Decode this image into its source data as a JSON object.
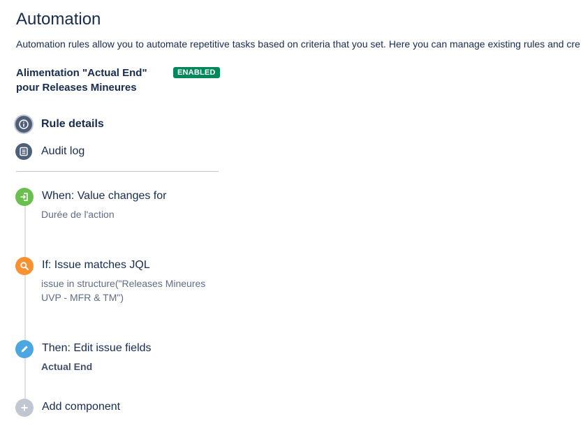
{
  "header": {
    "title": "Automation",
    "description": "Automation rules allow you to automate repetitive tasks based on criteria that you set. Here you can manage existing rules and cre"
  },
  "rule": {
    "name_line1": "Alimentation \"Actual End\"",
    "name_line2": "pour Releases Mineures",
    "status": "ENABLED"
  },
  "nav": {
    "items": [
      {
        "label": "Rule details",
        "icon": "info-icon",
        "active": true
      },
      {
        "label": "Audit log",
        "icon": "list-icon",
        "active": false
      }
    ]
  },
  "steps": [
    {
      "title": "When: Value changes for",
      "detail": "Durée de l'action",
      "icon": "trigger-icon",
      "color": "#6bbf4e"
    },
    {
      "title": "If: Issue matches JQL",
      "detail": "issue in structure(\"Releases Mineures UVP - MFR & TM\")",
      "icon": "search-icon",
      "color": "#f79232"
    },
    {
      "title": "Then: Edit issue fields",
      "detail": "Actual End",
      "icon": "pencil-icon",
      "color": "#4ca6e0"
    },
    {
      "title": "Add component",
      "icon": "plus-icon",
      "color": "#c1c7d0"
    }
  ],
  "colors": {
    "enabled_badge": "#00875a",
    "nav_icon": "#505f79"
  }
}
